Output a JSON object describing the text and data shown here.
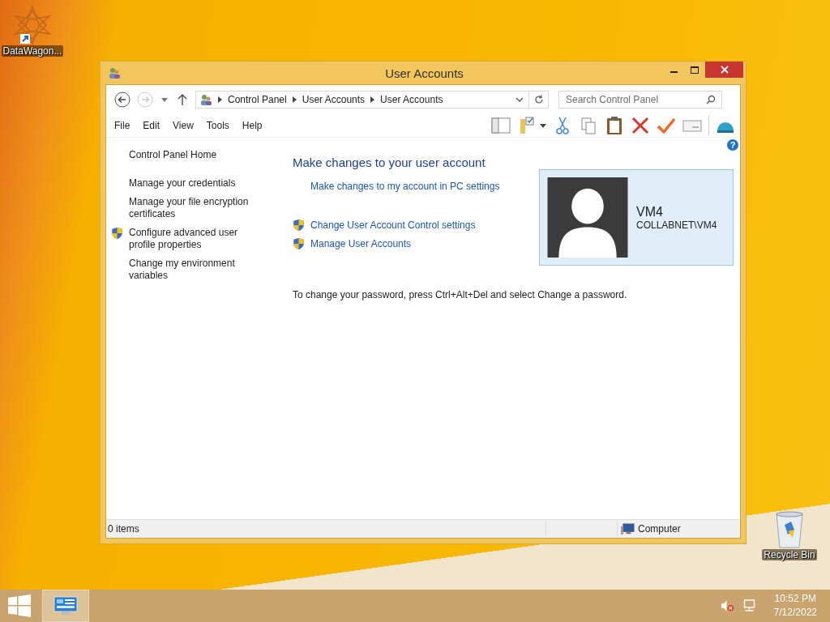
{
  "shortcut_icon": {
    "label": "DataWagon..."
  },
  "recycle_bin": {
    "label": "Recycle Bin"
  },
  "window": {
    "title": "User Accounts",
    "breadcrumbs": [
      "Control Panel",
      "User Accounts",
      "User Accounts"
    ],
    "search": {
      "placeholder": "Search Control Panel"
    },
    "menu": [
      "File",
      "Edit",
      "View",
      "Tools",
      "Help"
    ],
    "help_glyph": "?",
    "sidebar_groups": [
      {
        "items": [
          {
            "label": "Control Panel Home",
            "shield": false
          }
        ]
      },
      {
        "items": [
          {
            "label": "Manage your credentials",
            "shield": false
          },
          {
            "label": "Manage your file encryption certificates",
            "shield": false
          },
          {
            "label": "Configure advanced user profile properties",
            "shield": true
          },
          {
            "label": "Change my environment variables",
            "shield": false
          }
        ]
      }
    ],
    "heading": "Make changes to your user account",
    "link_groups": [
      {
        "items": [
          {
            "label": "Make changes to my account in PC settings",
            "shield": false
          }
        ]
      },
      {
        "items": [
          {
            "label": "Change User Account Control settings",
            "shield": true
          },
          {
            "label": "Manage User Accounts",
            "shield": true
          }
        ]
      }
    ],
    "user": {
      "name": "VM4",
      "account": "COLLABNET\\VM4"
    },
    "note": "To change your password, press Ctrl+Alt+Del and select Change a password.",
    "status_bar": {
      "count": "0 items",
      "location": "Computer"
    }
  },
  "taskbar": {
    "time": "10:52 PM",
    "date": "7/12/2022"
  }
}
